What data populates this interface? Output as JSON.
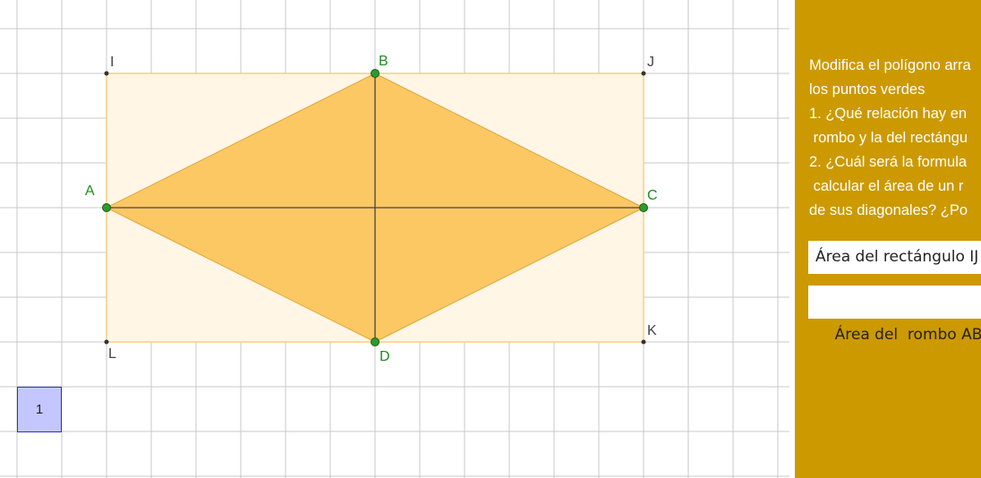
{
  "colors": {
    "panel_bg": "#cc9900",
    "rhombus_fill": "#fcc864",
    "rect_fill": "#fff6e6",
    "rect_stroke": "#f9cd80",
    "point_green": "#2e9a2e",
    "grid": "#c8c8c8"
  },
  "points": {
    "A": {
      "label": "A"
    },
    "B": {
      "label": "B"
    },
    "C": {
      "label": "C"
    },
    "D": {
      "label": "D"
    },
    "I": {
      "label": "I"
    },
    "J": {
      "label": "J"
    },
    "K": {
      "label": "K"
    },
    "L": {
      "label": "L"
    }
  },
  "counter": {
    "value": "1"
  },
  "panel": {
    "instructions": [
      "Modifica el polígono arra",
      "los puntos verdes",
      "1. ¿Qué relación hay en",
      " rombo y la del rectángu",
      "2. ¿Cuál será la formula",
      " calcular el área de un r",
      "de sus diagonales? ¿Po"
    ],
    "area_rect_label": "Área del rectángulo IJ",
    "area_rombo_label": "Área del  rombo ABC"
  }
}
